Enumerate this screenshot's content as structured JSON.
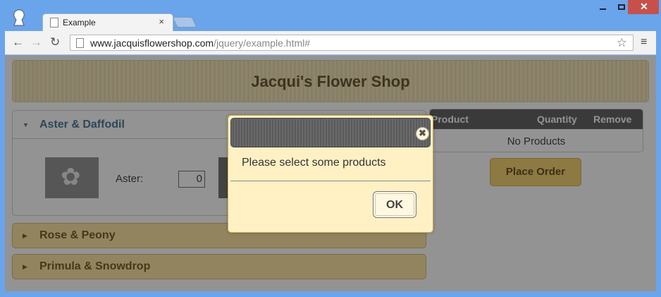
{
  "browser": {
    "tab_title": "Example",
    "tab_close": "×",
    "url_host": "www.jacquisflowershop.com",
    "url_path": "/jquery/example.html#",
    "window_controls": {
      "close": "✕"
    }
  },
  "page": {
    "header_title": "Jacqui's Flower Shop",
    "accordion": [
      {
        "label": "Aster & Daffodil",
        "expanded": true
      },
      {
        "label": "Rose & Peony",
        "expanded": false
      },
      {
        "label": "Primula & Snowdrop",
        "expanded": false
      }
    ],
    "product_label": "Aster:",
    "product_qty": "0",
    "basket": {
      "columns": [
        "Product",
        "Quantity",
        "Remove"
      ],
      "empty_text": "No Products"
    },
    "place_order_label": "Place Order"
  },
  "dialog": {
    "message": "Please select some products",
    "ok_label": "OK"
  },
  "icons": {
    "back": "back-arrow-icon",
    "forward": "forward-arrow-icon",
    "reload": "reload-icon",
    "star": "bookmark-star-icon",
    "menu": "hamburger-menu-icon"
  },
  "colors": {
    "accordion_bg": "#fde39b",
    "dialog_bg": "#fff1c4",
    "window_frame": "#6aa4ea",
    "close_button": "#c7504a"
  }
}
